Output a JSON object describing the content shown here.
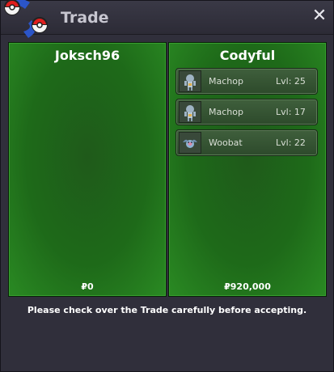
{
  "window": {
    "title": "Trade",
    "close_symbol": "✕"
  },
  "left_panel": {
    "player": "Joksch96",
    "money": "₽0",
    "items": []
  },
  "right_panel": {
    "player": "Codyful",
    "money": "₽920,000",
    "items": [
      {
        "name": "Machop",
        "level": "Lvl: 25",
        "icon": "machop-sprite-icon"
      },
      {
        "name": "Machop",
        "level": "Lvl: 17",
        "icon": "machop-sprite-icon"
      },
      {
        "name": "Woobat",
        "level": "Lvl: 22",
        "icon": "woobat-sprite-icon"
      }
    ]
  },
  "notice": "Please check over the Trade carefully before accepting.",
  "colors": {
    "panel_green": "#1e6a19",
    "window_bg": "#302f3b"
  }
}
